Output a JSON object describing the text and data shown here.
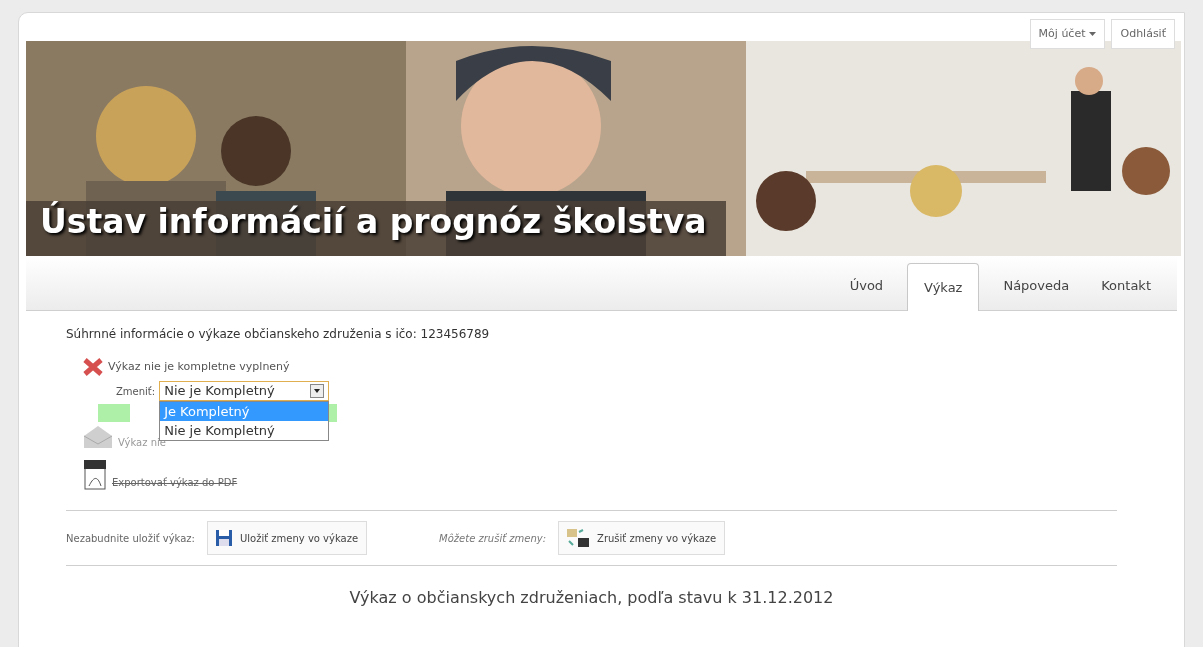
{
  "header": {
    "account_menu": "Môj účet",
    "logout": "Odhlásiť",
    "site_title": "Ústav informácií a prognóz školstva"
  },
  "tabs": [
    {
      "label": "Úvod",
      "selected": false
    },
    {
      "label": "Výkaz",
      "selected": true
    },
    {
      "label": "Nápoveda",
      "selected": false
    },
    {
      "label": "Kontakt",
      "selected": false
    }
  ],
  "summary": {
    "heading": "Súhrnné informácie o výkaze občianskeho združenia s ičo: 123456789",
    "status": "Výkaz nie je kompletne vyplnený",
    "complete": false,
    "change_label": "Zmeniť:",
    "select": {
      "value": "Nie je Kompletný",
      "expanded": true,
      "options": [
        {
          "label": "Je Kompletný",
          "highlighted": true
        },
        {
          "label": "Nie je Kompletný",
          "highlighted": false
        }
      ]
    },
    "covered_line": "Výkaz nie",
    "export_link": "Exportovať výkaz do PDF"
  },
  "actions": {
    "save_hint": "Nezabudnite uložiť výkaz:",
    "save_button": "Uložiť zmeny vo výkaze",
    "cancel_hint": "Môžete zrušiť zmeny:",
    "cancel_button": "Zrušiť zmeny vo výkaze"
  },
  "report_title": "Výkaz o občianskych združeniach, podľa stavu k 31.12.2012"
}
